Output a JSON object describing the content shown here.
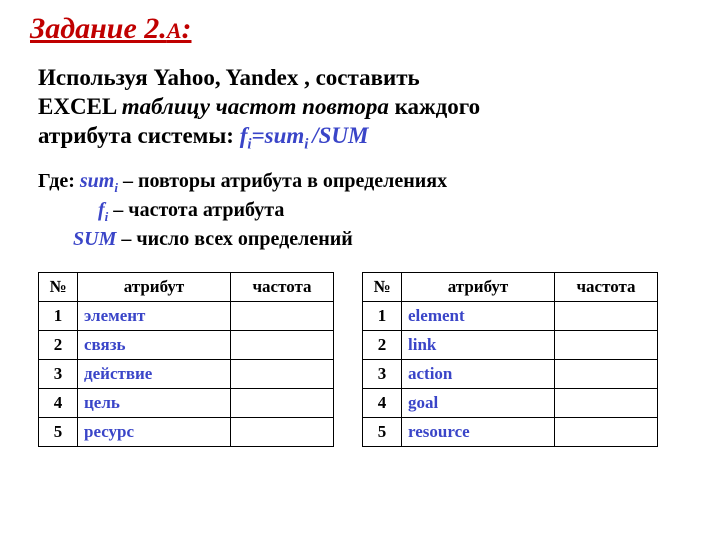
{
  "heading": {
    "main": "Задание 2.",
    "sub": "А",
    "colon": ":"
  },
  "intro": {
    "line1_a": "Используя Yahoo, Yandex , составить",
    "line2_a": "EXCEL ",
    "line2_b": "таблицу частот повтора",
    "line2_c": " каждого",
    "line3_a": "атрибута системы:   ",
    "formula_fi": "f",
    "formula_sub": "i",
    "formula_eq": "=sum",
    "formula_sub2": "i ",
    "formula_div": "/SUM"
  },
  "defs": {
    "where": "Где: ",
    "sum": "sum",
    "sum_sub": "i",
    "sum_desc": " – повторы атрибута в определениях",
    "pad_f": "            ",
    "f": "f",
    "f_sub": "i",
    "f_desc": " – частота атрибута",
    "pad_SUM": "       ",
    "SUM": "SUM",
    "SUM_desc": " – число всех определений"
  },
  "table_headers": {
    "num": "№",
    "attr": "атрибут",
    "freq": "частота"
  },
  "table_left": [
    {
      "n": "1",
      "attr": "элемент"
    },
    {
      "n": "2",
      "attr": "связь"
    },
    {
      "n": "3",
      "attr": "действие"
    },
    {
      "n": "4",
      "attr": "цель"
    },
    {
      "n": "5",
      "attr": "ресурс"
    }
  ],
  "table_right": [
    {
      "n": "1",
      "attr": "element"
    },
    {
      "n": "2",
      "attr": "link"
    },
    {
      "n": "3",
      "attr": "action"
    },
    {
      "n": "4",
      "attr": "goal"
    },
    {
      "n": "5",
      "attr": "resource"
    }
  ]
}
